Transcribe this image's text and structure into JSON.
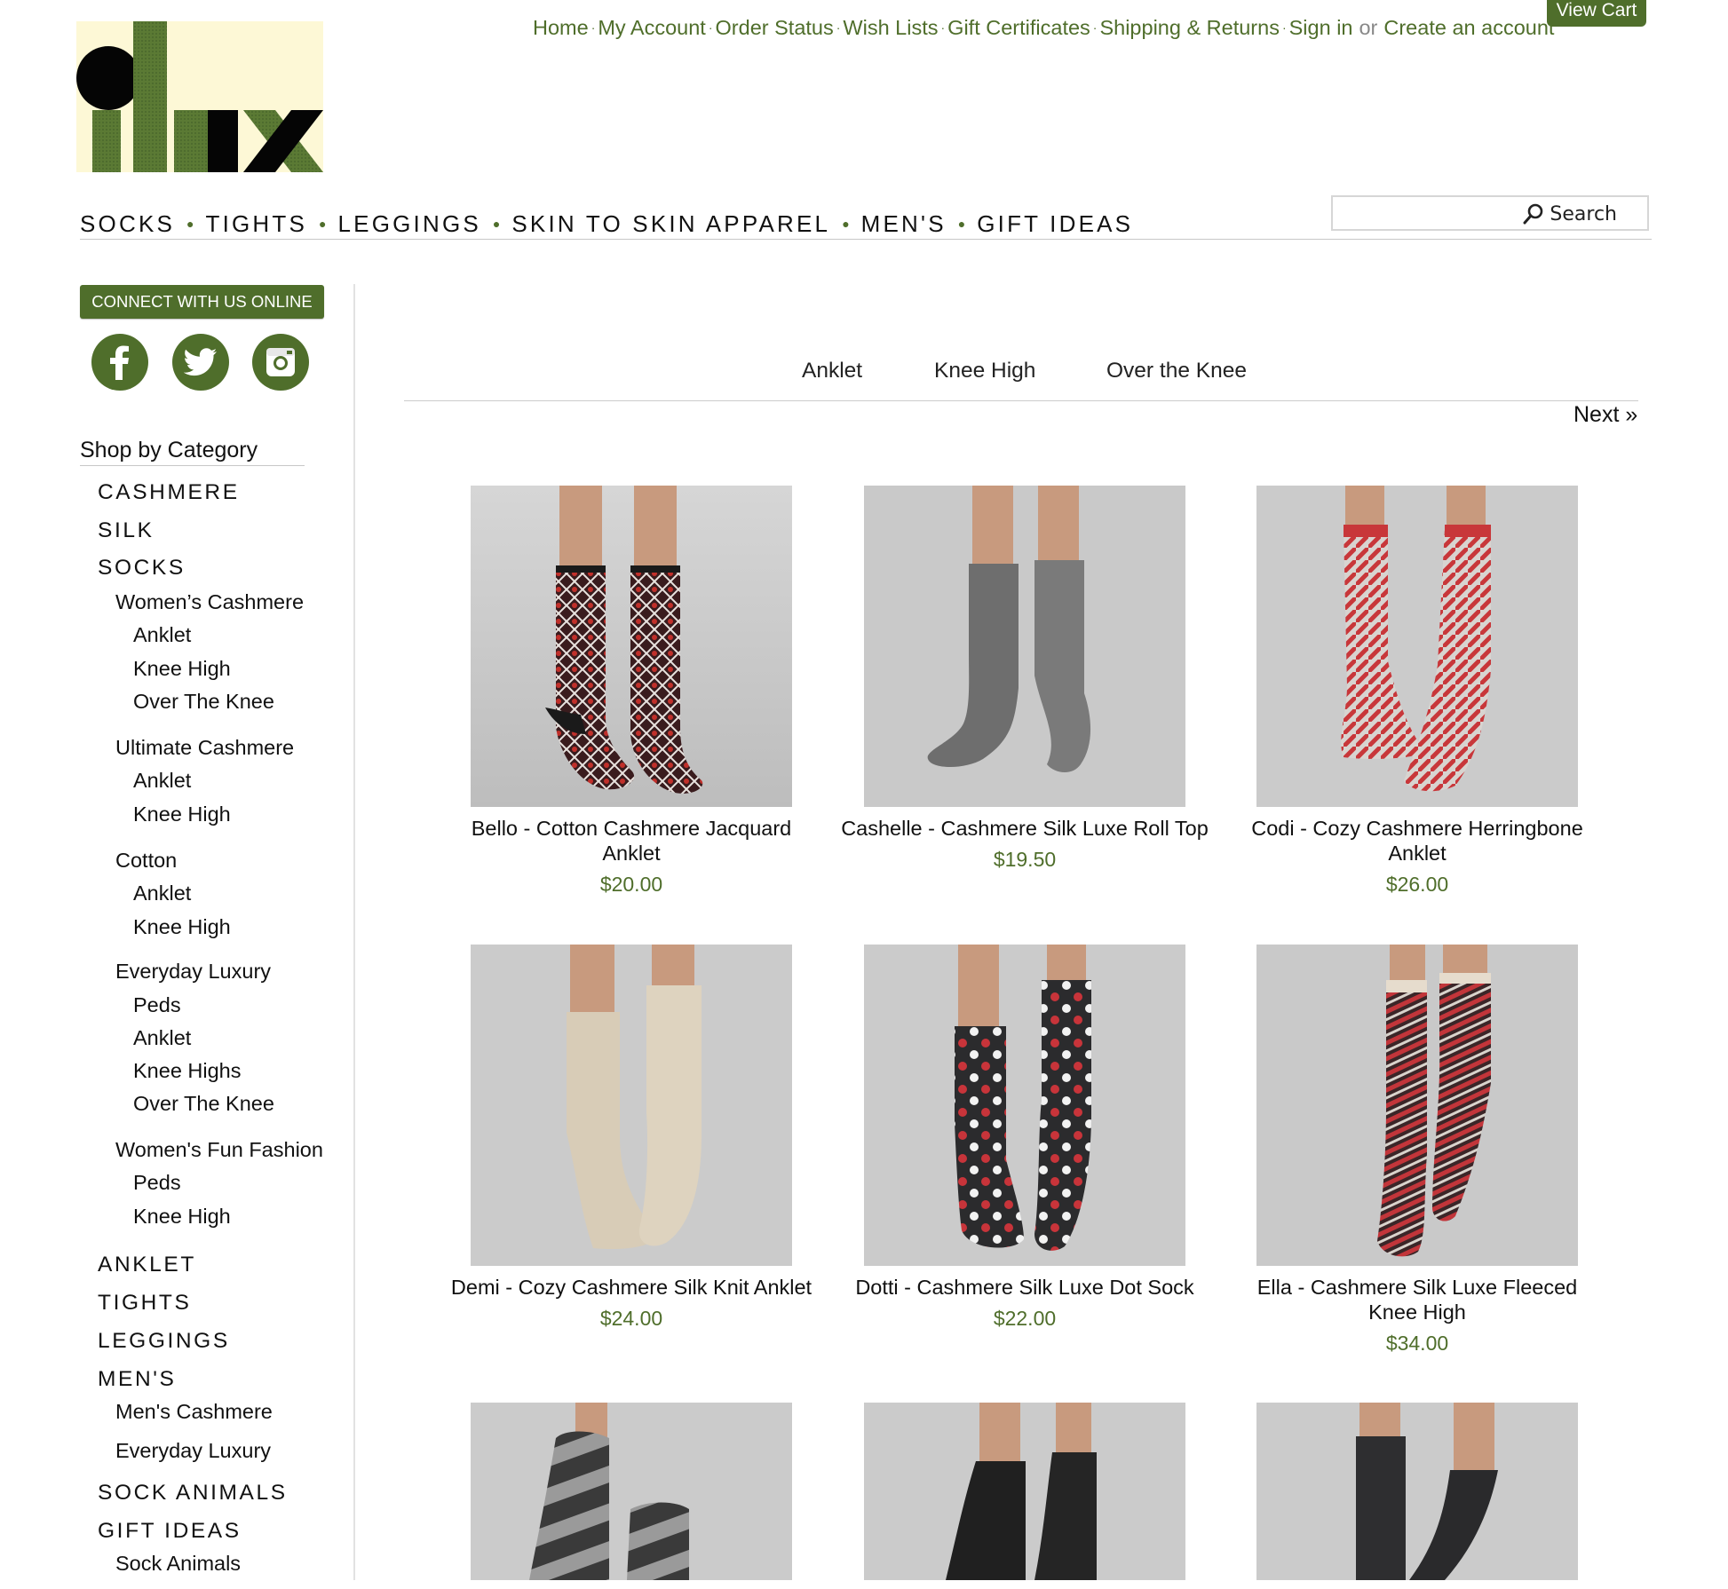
{
  "header": {
    "top_links": [
      "Home",
      "My Account",
      "Order Status",
      "Wish Lists",
      "Gift Certificates",
      "Shipping & Returns",
      "Sign in"
    ],
    "or_text": "or",
    "create_account": "Create an account",
    "view_cart": "View Cart",
    "search_label": "Search",
    "search_value": ""
  },
  "main_nav": [
    "SOCKS",
    "TIGHTS",
    "LEGGINGS",
    "SKIN TO SKIN APPAREL",
    "MEN'S",
    "GIFT IDEAS"
  ],
  "sidebar": {
    "connect": "CONNECT WITH US ONLINE",
    "social": [
      "facebook-icon",
      "twitter-icon",
      "instagram-icon"
    ],
    "category_title": "Shop by Category",
    "categories": [
      {
        "label": "CASHMERE",
        "level": 1
      },
      {
        "label": "SILK",
        "level": 1
      },
      {
        "label": "SOCKS",
        "level": 1
      },
      {
        "label": "Women’s Cashmere",
        "level": 2
      },
      {
        "label": "Anklet",
        "level": 3
      },
      {
        "label": "Knee High",
        "level": 3
      },
      {
        "label": "Over The Knee",
        "level": 3
      },
      {
        "label": "Ultimate Cashmere",
        "level": 2
      },
      {
        "label": "Anklet",
        "level": 3
      },
      {
        "label": "Knee High",
        "level": 3
      },
      {
        "label": "Cotton",
        "level": 2
      },
      {
        "label": "Anklet",
        "level": 3
      },
      {
        "label": "Knee High",
        "level": 3
      },
      {
        "label": "Everyday Luxury",
        "level": 2
      },
      {
        "label": "Peds",
        "level": 3
      },
      {
        "label": "Anklet",
        "level": 3
      },
      {
        "label": "Knee Highs",
        "level": 3
      },
      {
        "label": "Over The Knee",
        "level": 3
      },
      {
        "label": "Women's Fun Fashion",
        "level": 2
      },
      {
        "label": "Peds",
        "level": 3
      },
      {
        "label": "Knee High",
        "level": 3
      },
      {
        "label": "ANKLET",
        "level": 1
      },
      {
        "label": "TIGHTS",
        "level": 1
      },
      {
        "label": "LEGGINGS",
        "level": 1
      },
      {
        "label": "MEN'S",
        "level": 1
      },
      {
        "label": "Men's Cashmere",
        "level": 2
      },
      {
        "label": "Everyday Luxury",
        "level": 2
      },
      {
        "label": "SOCK ANIMALS",
        "level": 1
      },
      {
        "label": "GIFT IDEAS",
        "level": 1
      },
      {
        "label": "Sock Animals",
        "level": 2
      }
    ]
  },
  "content": {
    "filters": [
      "Anklet",
      "Knee High",
      "Over the Knee"
    ],
    "next": "Next »",
    "products": [
      {
        "name": "Bello - Cotton Cashmere Jacquard Anklet",
        "price": "$20.00"
      },
      {
        "name": "Cashelle - Cashmere Silk Luxe Roll Top",
        "price": "$19.50"
      },
      {
        "name": "Codi - Cozy Cashmere Herringbone Anklet",
        "price": "$26.00"
      },
      {
        "name": "Demi - Cozy Cashmere Silk Knit Anklet",
        "price": "$24.00"
      },
      {
        "name": "Dotti - Cashmere Silk Luxe Dot Sock",
        "price": "$22.00"
      },
      {
        "name": "Ella - Cashmere Silk Luxe Fleeced Knee High",
        "price": "$34.00"
      },
      {
        "name": "",
        "price": ""
      },
      {
        "name": "",
        "price": ""
      },
      {
        "name": "",
        "price": ""
      }
    ]
  },
  "colors": {
    "brand_green": "#4f6e2b",
    "logo_background": "#fdf8d6"
  }
}
